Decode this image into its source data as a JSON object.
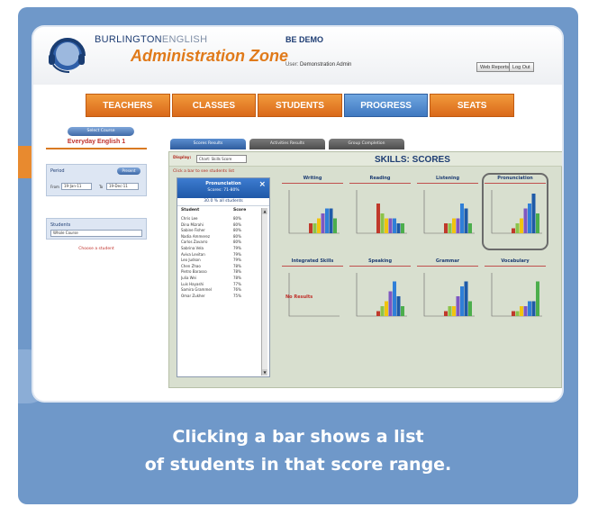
{
  "header": {
    "brand_left": "BURLINGTON",
    "brand_right": "ENGLISH",
    "zone_title": "Administration Zone",
    "demo_label": "BE DEMO",
    "user_label": "User:",
    "user_name": "Demonstration Admin",
    "reports_button": "Web Reports",
    "logout_button": "Log Out"
  },
  "nav": {
    "tabs": [
      "TEACHERS",
      "CLASSES",
      "STUDENTS",
      "PROGRESS",
      "SEATS"
    ],
    "active": "PROGRESS"
  },
  "left": {
    "pill_label": "Select Course",
    "course_name": "Everyday English 1",
    "period_label": "Period",
    "period_button": "Present",
    "from_label": "From",
    "from_value": "19-Jan-11",
    "to_label": "To",
    "to_value": "19-Dec-11",
    "students_label": "Students",
    "students_value": "Whole Course",
    "link_text": "Choose a student"
  },
  "subtabs": [
    "Scores Results",
    "Activities Results",
    "Group Completion"
  ],
  "main": {
    "display_label": "Display:",
    "display_value": "Chart: Skills Score",
    "title": "SKILLS: SCORES",
    "hint": "Click a bar to see students list"
  },
  "popup": {
    "title": "Pronunciation",
    "score": "Scores: 71-80%",
    "pct": "30.0 % all students",
    "col_student": "Student",
    "col_score": "Score",
    "rows": [
      {
        "name": "Chris Lee",
        "score": "80%"
      },
      {
        "name": "Dina Mizrahi",
        "score": "80%"
      },
      {
        "name": "Sabine Fisher",
        "score": "80%"
      },
      {
        "name": "Nadia Ammerez",
        "score": "80%"
      },
      {
        "name": "Carlos Zavarro",
        "score": "80%"
      },
      {
        "name": "Sabrina Vela",
        "score": "79%"
      },
      {
        "name": "Aviva Levitan",
        "score": "79%"
      },
      {
        "name": "Leo Judson",
        "score": "79%"
      },
      {
        "name": "Chen Zhao",
        "score": "78%"
      },
      {
        "name": "Pietro Barasso",
        "score": "78%"
      },
      {
        "name": "Julia Wei",
        "score": "78%"
      },
      {
        "name": "Luis Hayashi",
        "score": "77%"
      },
      {
        "name": "Samira Grammel",
        "score": "76%"
      },
      {
        "name": "Omar Zukher",
        "score": "75%"
      }
    ]
  },
  "chart_data": [
    {
      "type": "bar",
      "title": "Writing",
      "values": [
        2,
        2,
        3,
        4,
        5,
        5,
        3
      ]
    },
    {
      "type": "bar",
      "title": "Reading",
      "values": [
        6,
        4,
        3,
        3,
        3,
        2,
        2
      ]
    },
    {
      "type": "bar",
      "title": "Listening",
      "values": [
        2,
        2,
        3,
        3,
        6,
        5,
        2
      ]
    },
    {
      "type": "bar",
      "title": "Pronunciation",
      "values": [
        1,
        2,
        3,
        5,
        6,
        8,
        4
      ]
    },
    {
      "type": "bar",
      "title": "Integrated Skills",
      "values": [],
      "note": "No Results"
    },
    {
      "type": "bar",
      "title": "Speaking",
      "values": [
        1,
        2,
        3,
        5,
        7,
        4,
        2
      ]
    },
    {
      "type": "bar",
      "title": "Grammar",
      "values": [
        1,
        2,
        2,
        4,
        6,
        7,
        3
      ]
    },
    {
      "type": "bar",
      "title": "Vocabulary",
      "values": [
        1,
        1,
        2,
        2,
        3,
        3,
        7
      ]
    }
  ],
  "chart_colors": [
    "#c0392b",
    "#8bc34a",
    "#f1c40f",
    "#7e57c2",
    "#2f7fd8",
    "#1e5aa8",
    "#4cae4c"
  ],
  "caption": {
    "line1": "Clicking a bar shows a list",
    "line2": "of students in that score range."
  }
}
